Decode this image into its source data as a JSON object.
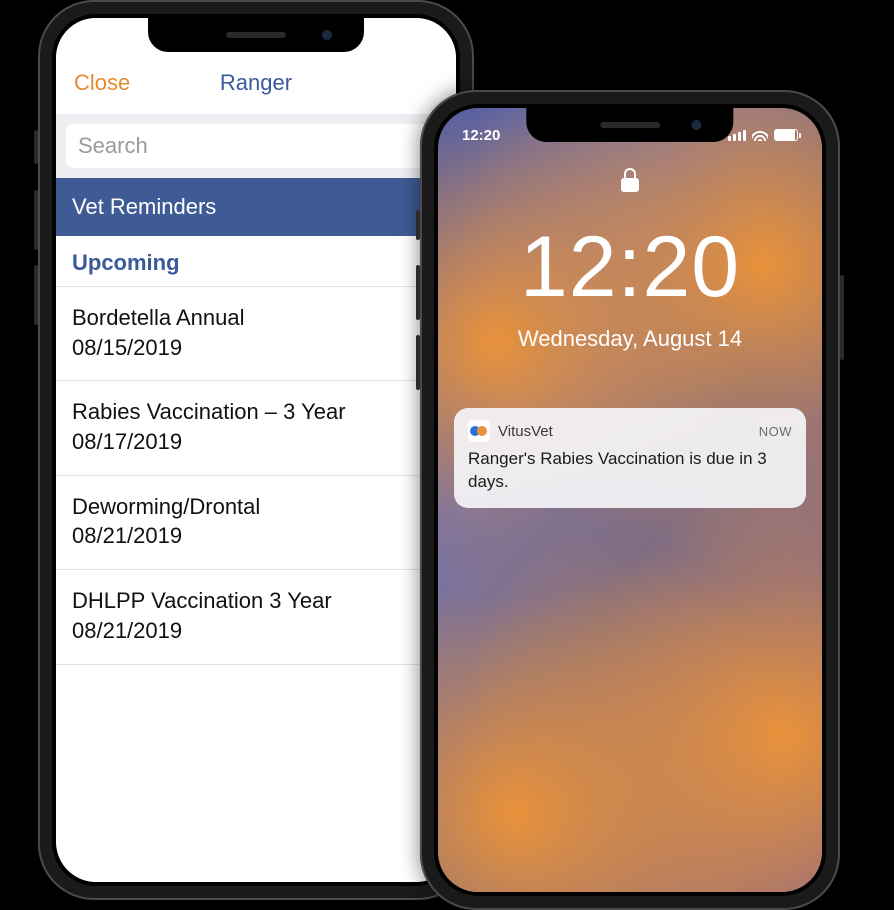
{
  "app": {
    "close_label": "Close",
    "title": "Ranger",
    "search_placeholder": "Search",
    "section_label": "Vet Reminders",
    "upcoming_label": "Upcoming",
    "items": [
      {
        "title": "Bordetella Annual",
        "date": "08/15/2019"
      },
      {
        "title": "Rabies Vaccination – 3 Year",
        "date": "08/17/2019"
      },
      {
        "title": "Deworming/Drontal",
        "date": "08/21/2019"
      },
      {
        "title": "DHLPP Vaccination 3 Year",
        "date": "08/21/2019"
      }
    ]
  },
  "lock": {
    "status_time": "12:20",
    "clock": "12:20",
    "date": "Wednesday, August 14",
    "notification": {
      "app_name": "VitusVet",
      "when": "NOW",
      "body": "Ranger's Rabies Vaccination is due in 3 days."
    }
  }
}
